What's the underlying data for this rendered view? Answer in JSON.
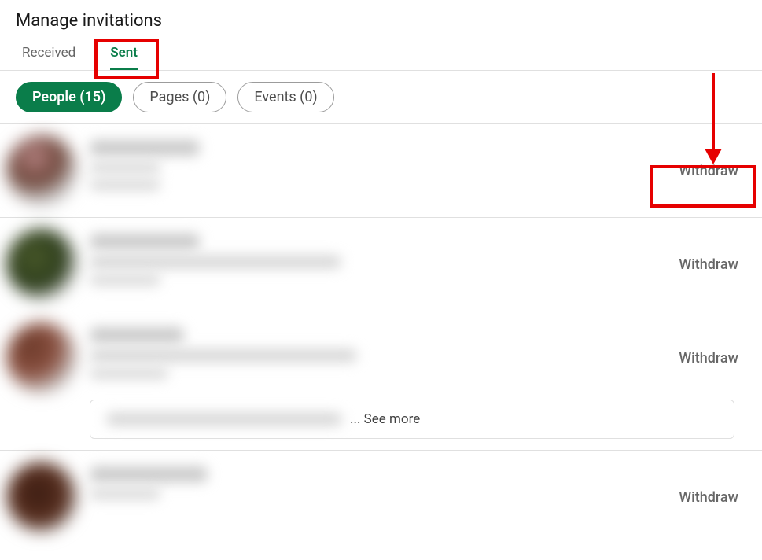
{
  "header": {
    "title": "Manage invitations"
  },
  "tabs": [
    {
      "label": "Received",
      "active": false
    },
    {
      "label": "Sent",
      "active": true
    }
  ],
  "filters": [
    {
      "label": "People (15)",
      "active": true
    },
    {
      "label": "Pages (0)",
      "active": false
    },
    {
      "label": "Events (0)",
      "active": false
    }
  ],
  "invites": [
    {
      "action": "Withdraw"
    },
    {
      "action": "Withdraw"
    },
    {
      "action": "Withdraw",
      "see_more": "... See more"
    },
    {
      "action": "Withdraw"
    }
  ],
  "annotations": {
    "sent_highlight": true,
    "withdraw_highlight": true,
    "arrow": true
  },
  "colors": {
    "accent": "#0a7d4a",
    "highlight": "#e60000"
  }
}
